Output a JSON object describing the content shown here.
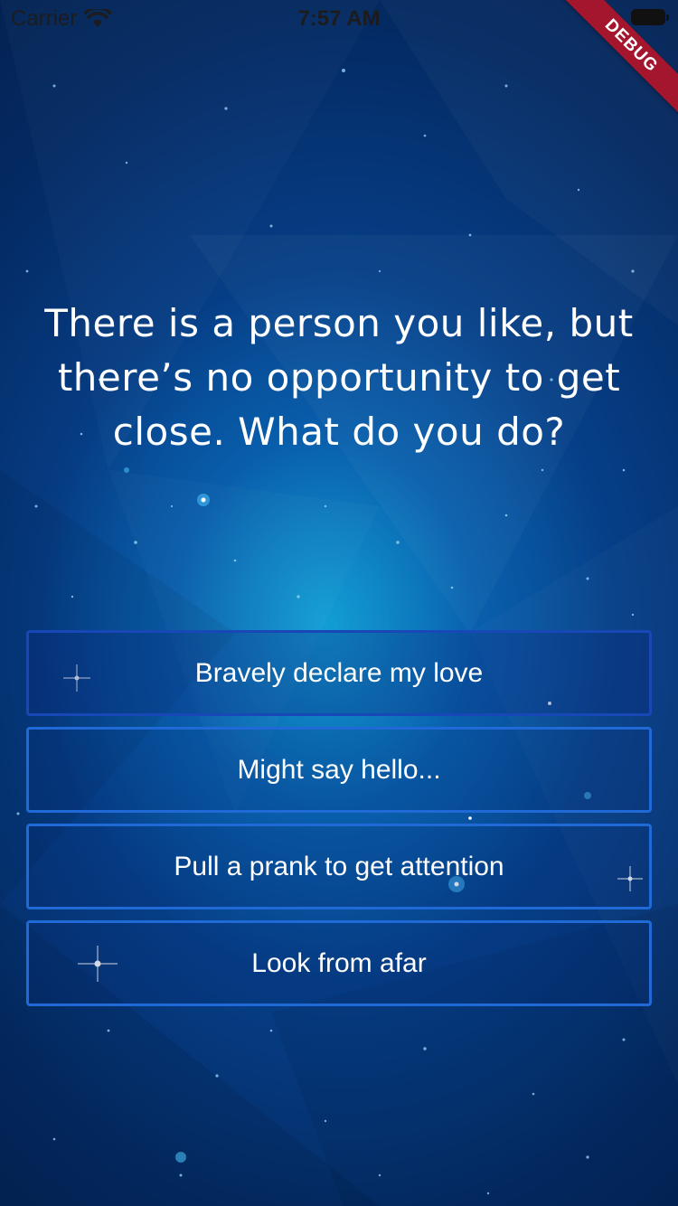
{
  "status_bar": {
    "carrier": "Carrier",
    "time": "7:57 AM"
  },
  "debug_banner": "DEBUG",
  "question": "There is a person you like, but there’s no opportunity to get close. What do you do?",
  "answers": [
    "Bravely declare my love",
    "Might say hello...",
    "Pull a prank to get attention",
    "Look from afar"
  ],
  "colors": {
    "background_top": "#03204f",
    "background_glow": "#14aadc",
    "button_border": "#1f6ad6",
    "debug_ribbon": "#a3162e",
    "text": "#ffffff"
  },
  "icons": {
    "wifi": "wifi-icon",
    "battery": "battery-icon"
  }
}
